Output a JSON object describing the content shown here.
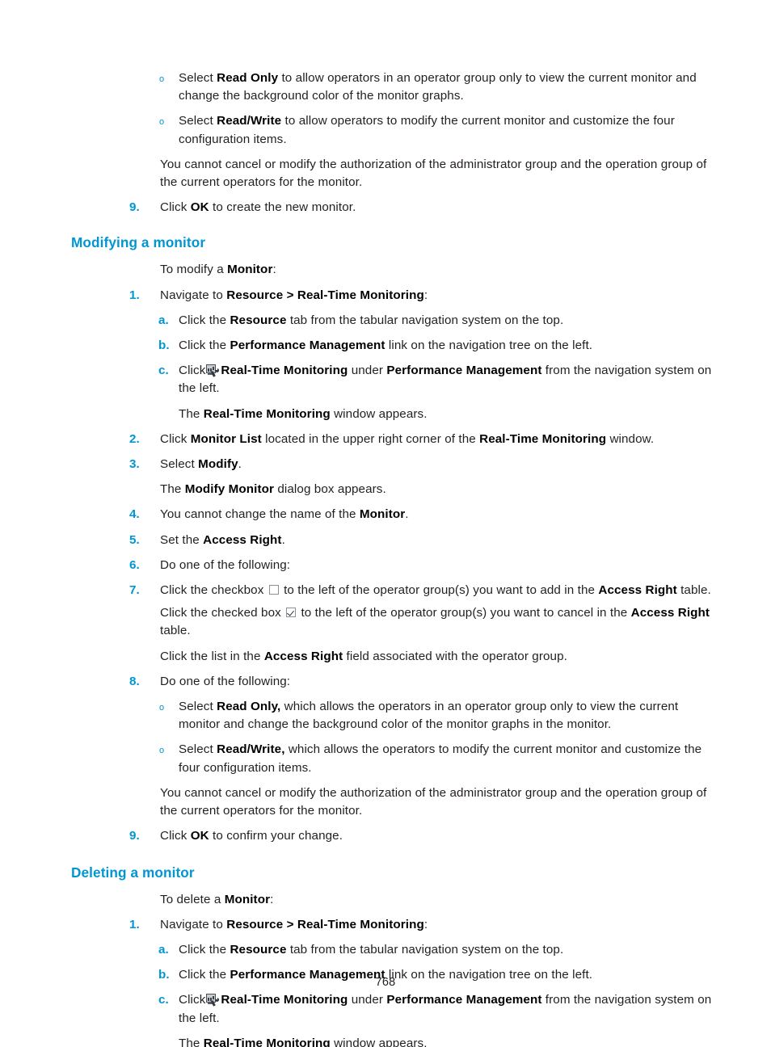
{
  "document": {
    "page_number": "768",
    "accent_color": "#0096d2",
    "body_color": "#231f20"
  },
  "top_section": {
    "bullets": [
      {
        "marker": "o",
        "parts": [
          {
            "t": "Select ",
            "b": false
          },
          {
            "t": "Read Only",
            "b": true
          },
          {
            "t": " to allow operators in an operator group only to view the current monitor and change the background color of the monitor graphs.",
            "b": false
          }
        ]
      },
      {
        "marker": "o",
        "parts": [
          {
            "t": "Select ",
            "b": false
          },
          {
            "t": "Read/Write",
            "b": true
          },
          {
            "t": " to allow operators to modify the current monitor and customize the four configuration items.",
            "b": false
          }
        ]
      }
    ],
    "note": "You cannot cancel or modify the authorization of the administrator group and the operation group of the current operators for the monitor.",
    "step9": {
      "marker": "9.",
      "parts": [
        {
          "t": "Click ",
          "b": false
        },
        {
          "t": "OK",
          "b": true
        },
        {
          "t": " to create the new monitor.",
          "b": false
        }
      ]
    }
  },
  "modifying": {
    "heading": "Modifying a monitor",
    "intro": [
      {
        "t": "To modify a ",
        "b": false
      },
      {
        "t": "Monitor",
        "b": true
      },
      {
        "t": ":",
        "b": false
      }
    ],
    "step1": {
      "marker": "1.",
      "parts": [
        {
          "t": "Navigate to ",
          "b": false
        },
        {
          "t": "Resource > Real-Time Monitoring",
          "b": true
        },
        {
          "t": ":",
          "b": false
        }
      ],
      "substeps": [
        {
          "marker": "a.",
          "parts": [
            {
              "t": "Click the ",
              "b": false
            },
            {
              "t": "Resource",
              "b": true
            },
            {
              "t": " tab from the tabular navigation system on the top.",
              "b": false
            }
          ]
        },
        {
          "marker": "b.",
          "parts": [
            {
              "t": "Click the ",
              "b": false
            },
            {
              "t": "Performance Management",
              "b": true
            },
            {
              "t": " link on the navigation tree on the left.",
              "b": false
            }
          ]
        },
        {
          "marker": "c.",
          "icon": "real-time-monitoring-icon",
          "parts_before_icon": [
            {
              "t": "Click",
              "b": false
            }
          ],
          "parts_after_icon": [
            {
              "t": "Real-Time Monitoring",
              "b": true
            },
            {
              "t": " under ",
              "b": false
            },
            {
              "t": "Performance Management",
              "b": true
            },
            {
              "t": " from the navigation system on the left.",
              "b": false
            }
          ]
        }
      ],
      "result": [
        {
          "t": "The ",
          "b": false
        },
        {
          "t": "Real-Time Monitoring",
          "b": true
        },
        {
          "t": " window appears.",
          "b": false
        }
      ]
    },
    "steps": [
      {
        "marker": "2.",
        "parts": [
          {
            "t": "Click ",
            "b": false
          },
          {
            "t": "Monitor List",
            "b": true
          },
          {
            "t": " located in the upper right corner of the ",
            "b": false
          },
          {
            "t": "Real-Time Monitoring",
            "b": true
          },
          {
            "t": " window.",
            "b": false
          }
        ]
      },
      {
        "marker": "3.",
        "parts": [
          {
            "t": "Select ",
            "b": false
          },
          {
            "t": "Modify",
            "b": true
          },
          {
            "t": ".",
            "b": false
          }
        ],
        "note": [
          {
            "t": "The ",
            "b": false
          },
          {
            "t": "Modify Monitor",
            "b": true
          },
          {
            "t": " dialog box appears.",
            "b": false
          }
        ]
      },
      {
        "marker": "4.",
        "parts": [
          {
            "t": "You cannot change the name of the ",
            "b": false
          },
          {
            "t": "Monitor",
            "b": true
          },
          {
            "t": ".",
            "b": false
          }
        ]
      },
      {
        "marker": "5.",
        "parts": [
          {
            "t": "Set the ",
            "b": false
          },
          {
            "t": "Access Right",
            "b": true
          },
          {
            "t": ".",
            "b": false
          }
        ]
      },
      {
        "marker": "6.",
        "parts": [
          {
            "t": "Do one of the following:",
            "b": false
          }
        ]
      }
    ],
    "step7": {
      "marker": "7.",
      "line1_before": "Click the checkbox ",
      "line1_checkbox": "unchecked-checkbox-icon",
      "line1_after_parts": [
        {
          "t": " to the left of the operator group(s) you want to add in the ",
          "b": false
        },
        {
          "t": "Access Right",
          "b": true
        },
        {
          "t": " table.",
          "b": false
        }
      ],
      "line2_before": "Click the checked box ",
      "line2_checkbox": "checked-checkbox-icon",
      "line2_after_parts": [
        {
          "t": " to the left of the operator group(s) you want to cancel in the ",
          "b": false
        },
        {
          "t": "Access Right",
          "b": true
        },
        {
          "t": " table.",
          "b": false
        }
      ],
      "line3_parts": [
        {
          "t": "Click the list in the ",
          "b": false
        },
        {
          "t": "Access Right",
          "b": true
        },
        {
          "t": " field associated with the operator group.",
          "b": false
        }
      ]
    },
    "step8": {
      "marker": "8.",
      "parts": [
        {
          "t": "Do one of the following:",
          "b": false
        }
      ],
      "bullets": [
        {
          "marker": "o",
          "parts": [
            {
              "t": "Select ",
              "b": false
            },
            {
              "t": "Read Only,",
              "b": true
            },
            {
              "t": " which allows the operators in an operator group only to view the current monitor and change the background color of the monitor graphs in the monitor.",
              "b": false
            }
          ]
        },
        {
          "marker": "o",
          "parts": [
            {
              "t": "Select ",
              "b": false
            },
            {
              "t": "Read/Write,",
              "b": true
            },
            {
              "t": " which allows the operators to modify the current monitor and customize the four configuration items.",
              "b": false
            }
          ]
        }
      ],
      "note": "You cannot cancel or modify the authorization of the administrator group and the operation group of the current operators for the monitor."
    },
    "step9": {
      "marker": "9.",
      "parts": [
        {
          "t": "Click ",
          "b": false
        },
        {
          "t": "OK",
          "b": true
        },
        {
          "t": " to confirm your change.",
          "b": false
        }
      ]
    }
  },
  "deleting": {
    "heading": "Deleting a monitor",
    "intro": [
      {
        "t": "To delete a ",
        "b": false
      },
      {
        "t": "Monitor",
        "b": true
      },
      {
        "t": ":",
        "b": false
      }
    ],
    "step1": {
      "marker": "1.",
      "parts": [
        {
          "t": "Navigate to ",
          "b": false
        },
        {
          "t": "Resource > Real-Time Monitoring",
          "b": true
        },
        {
          "t": ":",
          "b": false
        }
      ],
      "substeps": [
        {
          "marker": "a.",
          "parts": [
            {
              "t": "Click the ",
              "b": false
            },
            {
              "t": "Resource",
              "b": true
            },
            {
              "t": " tab from the tabular navigation system on the top.",
              "b": false
            }
          ]
        },
        {
          "marker": "b.",
          "parts": [
            {
              "t": "Click the ",
              "b": false
            },
            {
              "t": "Performance Management",
              "b": true
            },
            {
              "t": " link on the navigation tree on the left.",
              "b": false
            }
          ]
        },
        {
          "marker": "c.",
          "icon": "real-time-monitoring-icon",
          "parts_before_icon": [
            {
              "t": "Click",
              "b": false
            }
          ],
          "parts_after_icon": [
            {
              "t": "Real-Time Monitoring",
              "b": true
            },
            {
              "t": " under ",
              "b": false
            },
            {
              "t": "Performance Management",
              "b": true
            },
            {
              "t": " from the navigation system on the left.",
              "b": false
            }
          ]
        }
      ],
      "result": [
        {
          "t": "The ",
          "b": false
        },
        {
          "t": "Real-Time Monitoring",
          "b": true
        },
        {
          "t": " window appears.",
          "b": false
        }
      ]
    }
  }
}
